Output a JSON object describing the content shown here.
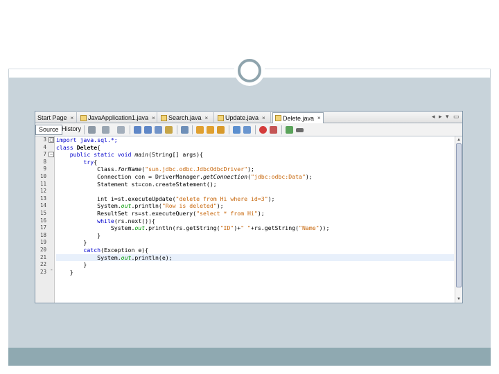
{
  "editor": {
    "tabs": [
      {
        "label": "Start Page",
        "icon": "start-page-icon",
        "active": false
      },
      {
        "label": "JavaApplication1.java",
        "icon": "java-file-icon",
        "active": false
      },
      {
        "label": "Search.java",
        "icon": "java-file-icon",
        "active": false
      },
      {
        "label": "Update.java",
        "icon": "java-file-icon",
        "active": false
      },
      {
        "label": "Delete.java",
        "icon": "java-file-icon",
        "active": true
      }
    ],
    "tab_close_glyph": "×",
    "tab_nav": {
      "left": "◂",
      "right": "▸",
      "menu": "▾",
      "restore": "▭"
    },
    "view_buttons": {
      "source": "Source",
      "history": "History"
    },
    "toolbar_icons": [
      "go-back-icon",
      "go-forward-icon",
      "last-edit-icon",
      "find-previous-icon",
      "find-next-icon",
      "find-selection-icon",
      "toggle-highlight-icon",
      "toggle-bookmark-icon",
      "previous-bookmark-icon",
      "next-bookmark-icon",
      "shift-left-icon",
      "shift-right-icon",
      "start-macro-icon",
      "stop-macro-icon",
      "comment-icon",
      "uncomment-icon"
    ],
    "line_numbers": [
      "3",
      "4",
      "7",
      "8",
      "9",
      "10",
      "11",
      "12",
      "13",
      "14",
      "15",
      "16",
      "17",
      "18",
      "19",
      "20",
      "21",
      "22",
      "23"
    ],
    "lines": [
      [
        {
          "t": "import java.sql.*;",
          "c": "kw"
        }
      ],
      [
        {
          "t": "class ",
          "c": "kw"
        },
        {
          "t": "Delete",
          "c": "bold"
        },
        {
          "t": "{",
          "c": ""
        }
      ],
      [
        {
          "t": "    public static void ",
          "c": "kw"
        },
        {
          "t": "main",
          "c": "ital"
        },
        {
          "t": "(String[] args){",
          "c": ""
        }
      ],
      [
        {
          "t": "        try",
          "c": "kw"
        },
        {
          "t": "{",
          "c": ""
        }
      ],
      [
        {
          "t": "            Class.",
          "c": ""
        },
        {
          "t": "forName",
          "c": "ital"
        },
        {
          "t": "(",
          "c": ""
        },
        {
          "t": "\"sun.jdbc.odbc.JdbcOdbcDriver\"",
          "c": "str"
        },
        {
          "t": ");",
          "c": ""
        }
      ],
      [
        {
          "t": "            Connection con = DriverManager.",
          "c": ""
        },
        {
          "t": "getConnection",
          "c": "ital"
        },
        {
          "t": "(",
          "c": ""
        },
        {
          "t": "\"jdbc:odbc:Data\"",
          "c": "str"
        },
        {
          "t": ");",
          "c": ""
        }
      ],
      [
        {
          "t": "            Statement st=con.createStatement();",
          "c": ""
        }
      ],
      [
        {
          "t": "",
          "c": ""
        }
      ],
      [
        {
          "t": "            int i=st.executeUpdate(",
          "c": ""
        },
        {
          "t": "\"delete from Hi where id=3\"",
          "c": "str"
        },
        {
          "t": ");",
          "c": ""
        }
      ],
      [
        {
          "t": "            System.",
          "c": ""
        },
        {
          "t": "out",
          "c": "fld"
        },
        {
          "t": ".println(",
          "c": ""
        },
        {
          "t": "\"Row is deleted\"",
          "c": "str"
        },
        {
          "t": ");",
          "c": ""
        }
      ],
      [
        {
          "t": "            ResultSet rs=st.executeQuery(",
          "c": ""
        },
        {
          "t": "\"select * from Hi\"",
          "c": "str"
        },
        {
          "t": ");",
          "c": ""
        }
      ],
      [
        {
          "t": "            while",
          "c": "kw"
        },
        {
          "t": "(rs.next()){",
          "c": ""
        }
      ],
      [
        {
          "t": "                System.",
          "c": ""
        },
        {
          "t": "out",
          "c": "fld"
        },
        {
          "t": ".println(rs.getString(",
          "c": ""
        },
        {
          "t": "\"ID\"",
          "c": "str"
        },
        {
          "t": ")+",
          "c": ""
        },
        {
          "t": "\" \"",
          "c": "str"
        },
        {
          "t": "+rs.getString(",
          "c": ""
        },
        {
          "t": "\"Name\"",
          "c": "str"
        },
        {
          "t": "));",
          "c": ""
        }
      ],
      [
        {
          "t": "            }",
          "c": ""
        }
      ],
      [
        {
          "t": "        }",
          "c": ""
        }
      ],
      [
        {
          "t": "        catch",
          "c": "kw"
        },
        {
          "t": "(Exception e){",
          "c": ""
        }
      ],
      [
        {
          "t": "            System.",
          "c": ""
        },
        {
          "t": "out",
          "c": "fld"
        },
        {
          "t": ".println(e);",
          "c": ""
        }
      ],
      [
        {
          "t": "        }",
          "c": ""
        }
      ],
      [
        {
          "t": "    }",
          "c": ""
        }
      ]
    ],
    "highlighted_line": 16,
    "scroll_up_glyph": "▲",
    "scroll_down_glyph": "▼"
  },
  "colors": {
    "slide_body": "#c8d3da",
    "slide_footer": "#8fa9b1",
    "keyword": "#0000cc",
    "string": "#c7660a",
    "static_field": "#009900"
  }
}
